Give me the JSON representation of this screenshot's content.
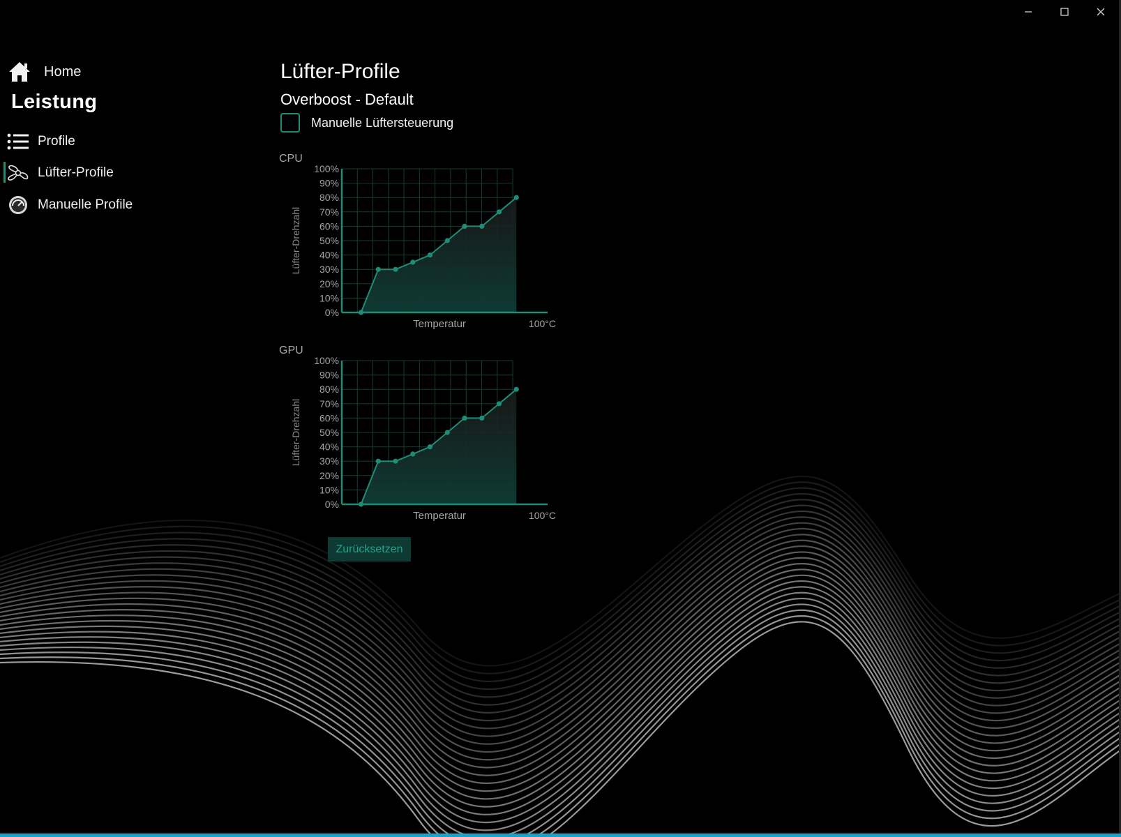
{
  "window": {
    "controls": [
      "minimize",
      "maximize",
      "close"
    ]
  },
  "sidebar": {
    "home": {
      "label": "Home",
      "icon": "home-icon"
    },
    "heading": "Leistung",
    "items": [
      {
        "label": "Profile",
        "icon": "list-icon"
      },
      {
        "label": "Lüfter-Profile",
        "icon": "fan-icon",
        "selected": true
      },
      {
        "label": "Manuelle Profile",
        "icon": "gauge-icon"
      }
    ]
  },
  "main": {
    "title": "Lüfter-Profile",
    "profile_name": "Overboost - Default",
    "manual_control": {
      "label": "Manuelle Lüftersteuerung",
      "checked": false
    },
    "reset_label": "Zurücksetzen"
  },
  "colors": {
    "accent": "#1f8c77",
    "accent_fill": "#0e3a33",
    "grid": "#153d36",
    "taskbar": "#18a3c8"
  },
  "chart_data": [
    {
      "type": "area",
      "title": "CPU",
      "xlabel": "Temperatur",
      "ylabel": "Lüfter-Drehzahl",
      "x_max_label": "100°C",
      "y_ticks": [
        "100%",
        "90%",
        "80%",
        "70%",
        "60%",
        "50%",
        "40%",
        "30%",
        "20%",
        "10%",
        "0%"
      ],
      "ylim": [
        0,
        100
      ],
      "xlim": [
        0,
        100
      ],
      "grid": true,
      "x": [
        10,
        19,
        28,
        37,
        46,
        55,
        64,
        73,
        82,
        91
      ],
      "values": [
        0,
        30,
        30,
        35,
        40,
        50,
        60,
        60,
        70,
        80
      ]
    },
    {
      "type": "area",
      "title": "GPU",
      "xlabel": "Temperatur",
      "ylabel": "Lüfter-Drehzahl",
      "x_max_label": "100°C",
      "y_ticks": [
        "100%",
        "90%",
        "80%",
        "70%",
        "60%",
        "50%",
        "40%",
        "30%",
        "20%",
        "10%",
        "0%"
      ],
      "ylim": [
        0,
        100
      ],
      "xlim": [
        0,
        100
      ],
      "grid": true,
      "x": [
        10,
        19,
        28,
        37,
        46,
        55,
        64,
        73,
        82,
        91
      ],
      "values": [
        0,
        30,
        30,
        35,
        40,
        50,
        60,
        60,
        70,
        80
      ]
    }
  ]
}
